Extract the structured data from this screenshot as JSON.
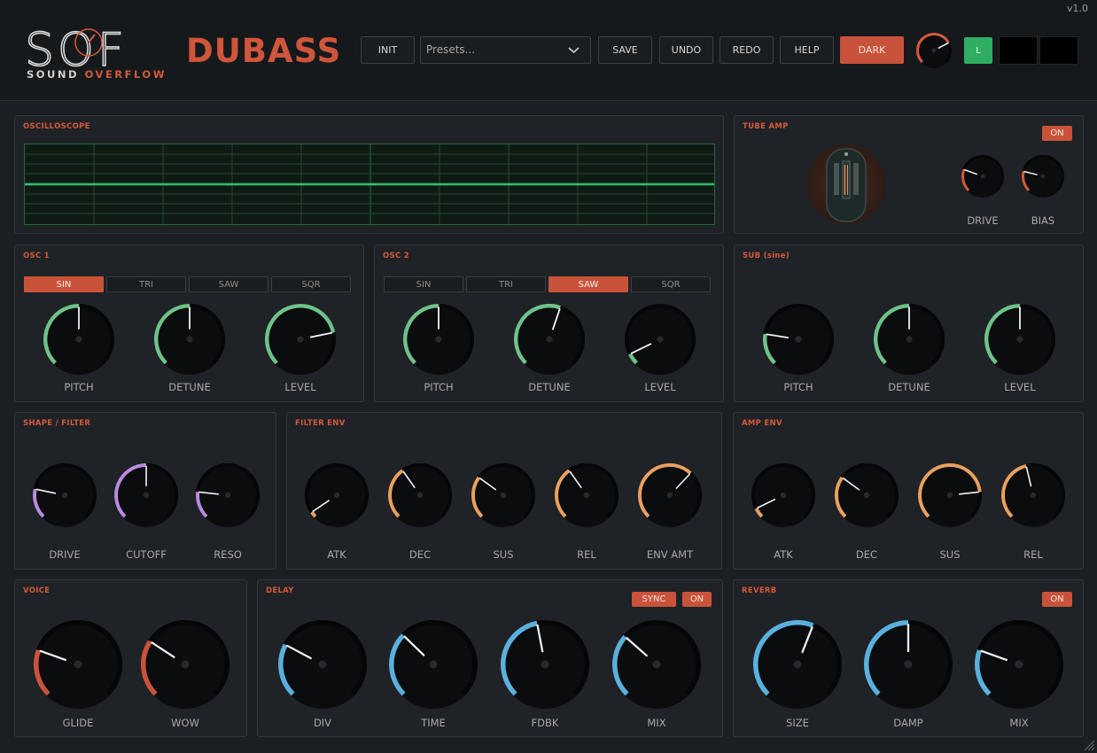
{
  "app": {
    "version": "v1.0",
    "logo_text": "SOF",
    "logo_sub_1": "SOUND ",
    "logo_sub_2": "OVERFLOW",
    "product": "DUBASS"
  },
  "toolbar": {
    "init": "INIT",
    "presets_placeholder": "Presets...",
    "save": "SAVE",
    "undo": "UNDO",
    "redo": "REDO",
    "help": "HELP",
    "theme": "DARK",
    "output_led": "L"
  },
  "colors": {
    "accent": "#d4593a",
    "green": "#6ec28a",
    "purple": "#b98ce0",
    "orange": "#e9a15f",
    "red": "#c9533a",
    "blue": "#5ab0dd",
    "scope_line": "#3ee07f"
  },
  "panels": {
    "oscilloscope": {
      "title": "OSCILLOSCOPE"
    },
    "tube_amp": {
      "title": "TUBE AMP",
      "on": "ON",
      "drive": "DRIVE",
      "bias": "BIAS"
    },
    "osc1": {
      "title": "OSC 1",
      "waves": [
        "SIN",
        "TRI",
        "SAW",
        "SQR"
      ],
      "selected": "SIN",
      "pitch": "PITCH",
      "detune": "DETUNE",
      "level": "LEVEL"
    },
    "osc2": {
      "title": "OSC 2",
      "waves": [
        "SIN",
        "TRI",
        "SAW",
        "SQR"
      ],
      "selected": "SAW",
      "pitch": "PITCH",
      "detune": "DETUNE",
      "level": "LEVEL"
    },
    "sub": {
      "title": "SUB (sine)",
      "pitch": "PITCH",
      "detune": "DETUNE",
      "level": "LEVEL"
    },
    "shape": {
      "title": "SHAPE / FILTER",
      "drive": "DRIVE",
      "cutoff": "CUTOFF",
      "reso": "RESO"
    },
    "filter_env": {
      "title": "FILTER ENV",
      "atk": "ATK",
      "dec": "DEC",
      "sus": "SUS",
      "rel": "REL",
      "env_amt": "ENV AMT"
    },
    "amp_env": {
      "title": "AMP ENV",
      "atk": "ATK",
      "dec": "DEC",
      "sus": "SUS",
      "rel": "REL"
    },
    "voice": {
      "title": "VOICE",
      "glide": "GLIDE",
      "wow": "WOW"
    },
    "delay": {
      "title": "DELAY",
      "sync": "SYNC",
      "on": "ON",
      "div": "DIV",
      "time": "TIME",
      "fdbk": "FDBK",
      "mix": "MIX"
    },
    "reverb": {
      "title": "REVERB",
      "on": "ON",
      "size": "SIZE",
      "damp": "DAMP",
      "mix": "MIX"
    }
  },
  "knob_values": {
    "master": 0.73,
    "tube_drive": 0.24,
    "tube_bias": 0.22,
    "osc1_pitch": 0.5,
    "osc1_detune": 0.5,
    "osc1_level": 0.79,
    "osc2_pitch": 0.5,
    "osc2_detune": 0.57,
    "osc2_level": 0.07,
    "sub_pitch": 0.2,
    "sub_detune": 0.5,
    "sub_level": 0.5,
    "shape_drive": 0.21,
    "shape_cutoff": 0.5,
    "shape_reso": 0.19,
    "fenv_atk": 0.04,
    "fenv_dec": 0.37,
    "fenv_sus": 0.3,
    "fenv_rel": 0.37,
    "fenv_amt": 0.66,
    "aenv_atk": 0.07,
    "aenv_dec": 0.3,
    "aenv_sus": 0.81,
    "aenv_rel": 0.45,
    "voice_glide": 0.24,
    "voice_wow": 0.29,
    "delay_div": 0.27,
    "delay_time": 0.33,
    "delay_fdbk": 0.46,
    "delay_mix": 0.32,
    "reverb_size": 0.58,
    "reverb_damp": 0.5,
    "reverb_mix": 0.24
  }
}
